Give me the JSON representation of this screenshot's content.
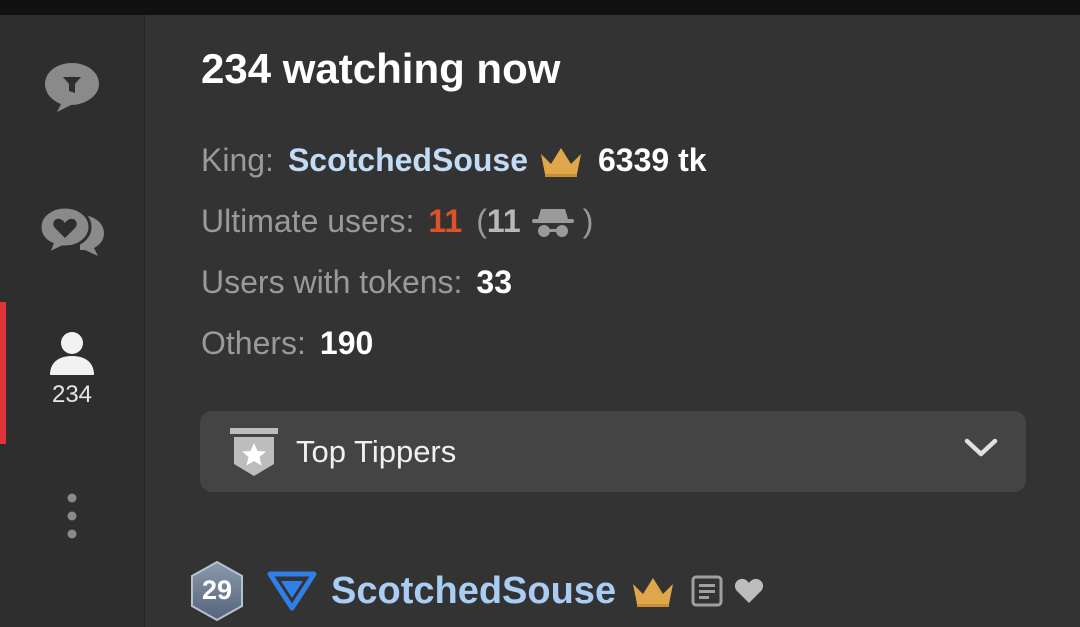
{
  "sidebar": {
    "items": [
      {
        "name": "chat",
        "icon": "chat-bubble-icon"
      },
      {
        "name": "private-messages",
        "icon": "heart-chat-icon"
      },
      {
        "name": "users",
        "icon": "user-icon",
        "count": "234",
        "active": true
      },
      {
        "name": "more",
        "icon": "more-vertical-icon"
      }
    ],
    "active_color": "#e0323a"
  },
  "main": {
    "title": "234 watching now",
    "king": {
      "label": "King:",
      "name": "ScotchedSouse",
      "icon": "crown-icon",
      "tokens": "6339 tk"
    },
    "ultimate": {
      "label": "Ultimate users:",
      "count": "11",
      "paren_open": "(",
      "anon_count": "11",
      "anon_icon": "incognito-icon",
      "paren_close": ")"
    },
    "tokens": {
      "label": "Users with tokens:",
      "count": "33"
    },
    "others": {
      "label": "Others:",
      "count": "190"
    },
    "dropdown": {
      "label": "Top Tippers",
      "icon": "star-shield-icon",
      "chevron": "chevron-down-icon"
    },
    "user_row": {
      "level": "29",
      "name": "ScotchedSouse",
      "icons": [
        "triangle-badge-icon",
        "crown-icon",
        "note-icon",
        "heart-icon"
      ]
    }
  },
  "colors": {
    "king_name": "#c3dcf5",
    "ultimate_count": "#e0522a",
    "crown": "#e0a74a",
    "triangle": "#2f7fe8"
  }
}
